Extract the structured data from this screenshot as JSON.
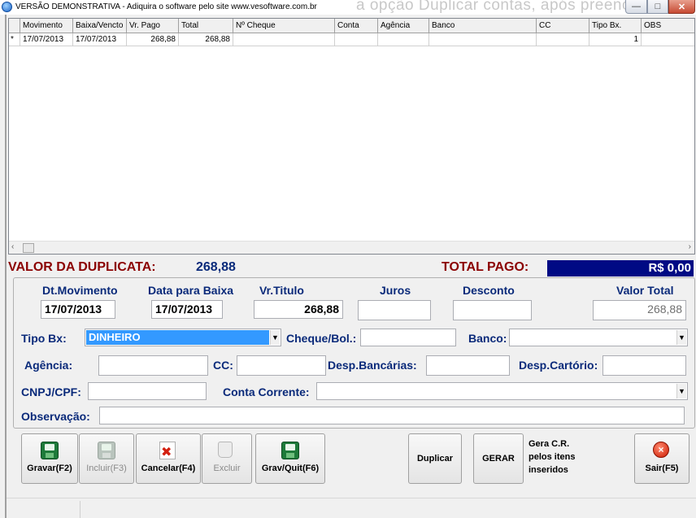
{
  "window": {
    "title": "VERSÃO DEMONSTRATIVA - Adiquira o software pelo site www.vesoftware.com.br",
    "background_text": "a opção Duplicar contas, após preenc"
  },
  "grid": {
    "columns": [
      "Movimento",
      "Baixa/Vencto",
      "Vr. Pago",
      "Total",
      "Nº Cheque",
      "Conta",
      "Agência",
      "Banco",
      "CC",
      "Tipo Bx.",
      "OBS"
    ],
    "rows": [
      {
        "marker": "*",
        "movimento": "17/07/2013",
        "baixa": "17/07/2013",
        "vr_pago": "268,88",
        "total": "268,88",
        "cheque": "",
        "conta": "",
        "agencia": "",
        "banco": "",
        "cc": "",
        "tipo": "1",
        "obs": ""
      }
    ]
  },
  "summary": {
    "valor_label": "VALOR DA DUPLICATA:",
    "valor_value": "268,88",
    "total_label": "TOTAL PAGO:",
    "total_value": "R$ 0,00"
  },
  "form": {
    "dt_movimento_label": "Dt.Movimento",
    "dt_movimento": "17/07/2013",
    "data_baixa_label": "Data para Baixa",
    "data_baixa": "17/07/2013",
    "vr_titulo_label": "Vr.Titulo",
    "vr_titulo": "268,88",
    "juros_label": "Juros",
    "juros": "",
    "desconto_label": "Desconto",
    "desconto": "",
    "valor_total_label": "Valor Total",
    "valor_total": "268,88",
    "tipo_bx_label": "Tipo Bx:",
    "tipo_bx": "DINHEIRO",
    "cheque_label": "Cheque/Bol.:",
    "cheque": "",
    "banco_label": "Banco:",
    "banco": "",
    "agencia_label": "Agência:",
    "agencia": "",
    "cc_label": "CC:",
    "cc": "",
    "desp_bancarias_label": "Desp.Bancárias:",
    "desp_bancarias": "",
    "desp_cartorio_label": "Desp.Cartório:",
    "desp_cartorio": "",
    "cnpj_label": "CNPJ/CPF:",
    "cnpj": "",
    "conta_corrente_label": "Conta Corrente:",
    "conta_corrente": "",
    "observacao_label": "Observação:",
    "observacao": ""
  },
  "toolbar": {
    "gravar": "Gravar(F2)",
    "incluir": "Incluir(F3)",
    "cancelar": "Cancelar(F4)",
    "excluir": "Excluir",
    "grav_quit": "Grav/Quit(F6)",
    "duplicar": "Duplicar",
    "gerar": "GERAR",
    "gera_cr_line1": "Gera C.R.",
    "gera_cr_line2": "pelos itens",
    "gera_cr_line3": "inseridos",
    "sair": "Sair(F5)"
  },
  "colors": {
    "label_navy": "#0a2a7a",
    "valor_red": "#8b0000",
    "total_box": "#000a84",
    "selection_blue": "#3399ff"
  }
}
